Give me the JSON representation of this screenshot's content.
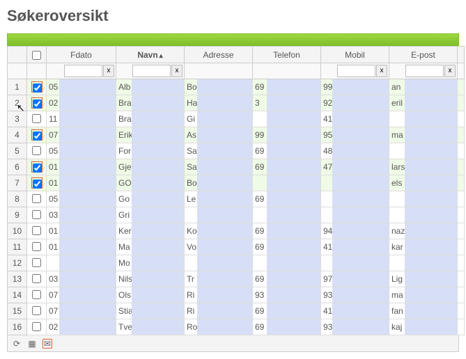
{
  "title": "Søkeroversikt",
  "headers": {
    "fdato": "Fdato",
    "navn": "Navn",
    "adresse": "Adresse",
    "telefon": "Telefon",
    "mobil": "Mobil",
    "epost": "E-post"
  },
  "clear": "x",
  "rows": [
    {
      "n": "1",
      "sel": true,
      "hl": true,
      "fd": "05",
      "nv": "Alb",
      "ad": "Bo",
      "tl": "69",
      "mb": "99",
      "ep": "an"
    },
    {
      "n": "2",
      "sel": true,
      "hl": true,
      "fd": "02",
      "nv": "Bra",
      "ad": "Ha",
      "tl": "3",
      "mb": "92",
      "ep": "eril"
    },
    {
      "n": "3",
      "sel": false,
      "hl": false,
      "fd": "11",
      "nv": "Bra",
      "ad": "Gi",
      "tl": "",
      "mb": "41",
      "ep": ""
    },
    {
      "n": "4",
      "sel": true,
      "hl": true,
      "fd": "07",
      "nv": "Erik",
      "ad": "As",
      "tl": "99",
      "mb": "95",
      "ep": "ma"
    },
    {
      "n": "5",
      "sel": false,
      "hl": false,
      "fd": "05",
      "nv": "For",
      "ad": "Sa",
      "tl": "69",
      "mb": "48",
      "ep": ""
    },
    {
      "n": "6",
      "sel": true,
      "hl": true,
      "fd": "01",
      "nv": "Gje",
      "ad": "Sa",
      "tl": "69",
      "mb": "47",
      "ep": "lars"
    },
    {
      "n": "7",
      "sel": true,
      "hl": true,
      "fd": "01",
      "nv": "GO",
      "ad": "Bo",
      "tl": "",
      "mb": "",
      "ep": "els"
    },
    {
      "n": "8",
      "sel": false,
      "hl": false,
      "fd": "05",
      "nv": "Go",
      "ad": "Le",
      "tl": "69",
      "mb": "",
      "ep": ""
    },
    {
      "n": "9",
      "sel": false,
      "hl": false,
      "fd": "03",
      "nv": "Gri",
      "ad": "",
      "tl": "",
      "mb": "",
      "ep": ""
    },
    {
      "n": "10",
      "sel": false,
      "hl": false,
      "fd": "01",
      "nv": "Ker",
      "ad": "Ko",
      "tl": "69",
      "mb": "94",
      "ep": "naz"
    },
    {
      "n": "11",
      "sel": false,
      "hl": false,
      "fd": "01",
      "nv": "Ma",
      "ad": "Vo",
      "tl": "69",
      "mb": "41",
      "ep": "kar"
    },
    {
      "n": "12",
      "sel": false,
      "hl": false,
      "fd": "",
      "nv": "Mo",
      "ad": "",
      "tl": "",
      "mb": "",
      "ep": ""
    },
    {
      "n": "13",
      "sel": false,
      "hl": false,
      "fd": "03",
      "nv": "Nils",
      "ad": "Tr",
      "tl": "69",
      "mb": "97",
      "ep": "Lig"
    },
    {
      "n": "14",
      "sel": false,
      "hl": false,
      "fd": "07",
      "nv": "Ols",
      "ad": "Ri",
      "tl": "93",
      "mb": "93",
      "ep": "ma"
    },
    {
      "n": "15",
      "sel": false,
      "hl": false,
      "fd": "07",
      "nv": "Stia",
      "ad": "Ri",
      "tl": "69",
      "mb": "41",
      "ep": "fan"
    },
    {
      "n": "16",
      "sel": false,
      "hl": false,
      "fd": "02",
      "nv": "Tve",
      "ad": "Ro",
      "tl": "69",
      "mb": "93",
      "ep": "kaj"
    }
  ]
}
